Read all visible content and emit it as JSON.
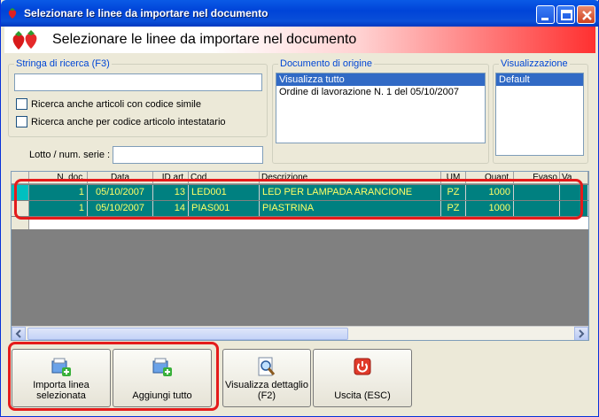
{
  "window": {
    "title": "Selezionare le linee da importare nel documento"
  },
  "header": {
    "title": "Selezionare le linee da importare nel documento"
  },
  "search": {
    "legend": "Stringa di ricerca (F3)",
    "value": "",
    "similar_code_label": "Ricerca anche articoli con codice simile",
    "holder_code_label": "Ricerca anche per codice articolo intestatario",
    "lot_label": "Lotto / num. serie :",
    "lot_value": ""
  },
  "origin": {
    "legend": "Documento di origine",
    "items": [
      "Visualizza tutto",
      "Ordine di lavorazione N. 1 del 05/10/2007"
    ],
    "selected_index": 0
  },
  "view": {
    "legend": "Visualizzazione",
    "items": [
      "Default"
    ],
    "selected_index": 0
  },
  "grid": {
    "columns": [
      "N. doc.",
      "Data",
      "ID art.",
      "Cod.",
      "Descrizione",
      "UM",
      "Quant.",
      "Evaso",
      "Va"
    ],
    "rows": [
      [
        "1",
        "05/10/2007",
        "13",
        "LED001",
        "LED PER LAMPADA ARANCIONE",
        "PZ",
        "1000",
        "",
        ""
      ],
      [
        "1",
        "05/10/2007",
        "14",
        "PIAS001",
        "PIASTRINA",
        "PZ",
        "1000",
        "",
        ""
      ]
    ]
  },
  "buttons": {
    "import_selected": "Importa linea\nselezionata",
    "add_all": "Aggiungi tutto",
    "view_detail": "Visualizza dettaglio\n(F2)",
    "exit": "Uscita (ESC)"
  },
  "colors": {
    "row_bg": "#008080",
    "row_text": "#ffff66",
    "highlight": "#e41b1b",
    "title_bar": "#0a5ae6"
  },
  "icons": [
    "strawberry-icon",
    "minimize-icon",
    "maximize-icon",
    "close-icon",
    "import-line-icon",
    "add-all-icon",
    "magnifier-document-icon",
    "power-icon",
    "scroll-left-icon",
    "scroll-right-icon"
  ]
}
